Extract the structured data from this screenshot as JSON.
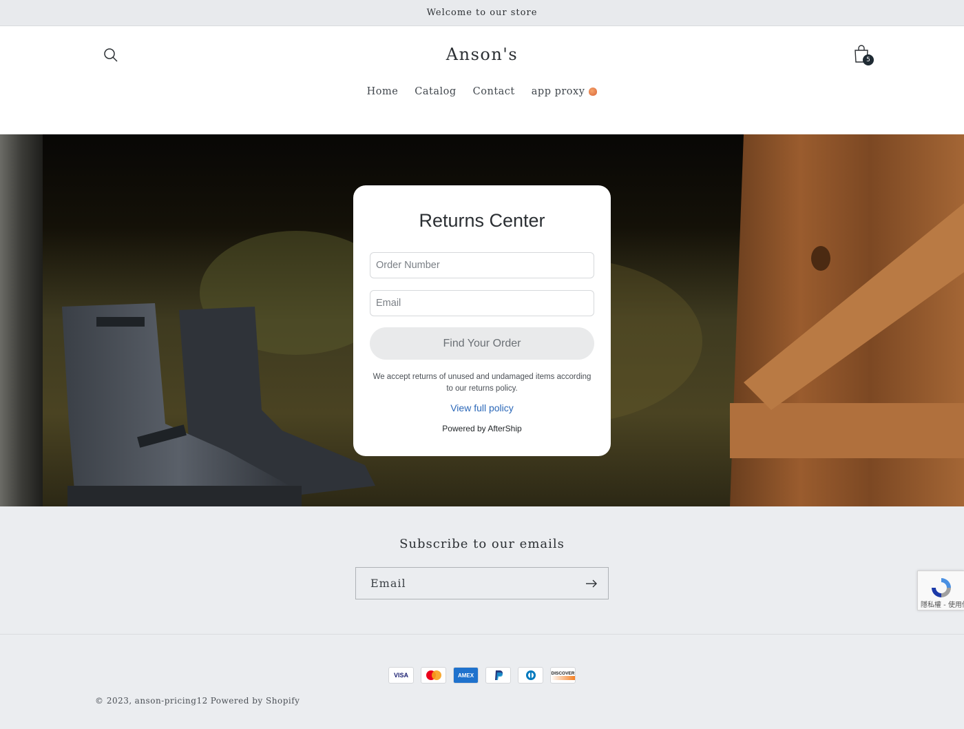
{
  "announcement": "Welcome to our store",
  "header": {
    "logo": "Anson's",
    "cart_count": "5",
    "nav": [
      {
        "label": "Home"
      },
      {
        "label": "Catalog"
      },
      {
        "label": "Contact"
      },
      {
        "label": "app proxy"
      }
    ]
  },
  "returns": {
    "title": "Returns Center",
    "order_placeholder": "Order Number",
    "email_placeholder": "Email",
    "button": "Find Your Order",
    "policy_text": "We accept returns of unused and undamaged items according to our returns policy.",
    "policy_link": "View full policy",
    "powered": "Powered by AfterShip"
  },
  "subscribe": {
    "title": "Subscribe to our emails",
    "email_placeholder": "Email"
  },
  "recaptcha": {
    "text": "隱私權 - 使用條款"
  },
  "payments": [
    "VISA",
    "Mastercard",
    "AMEX",
    "PayPal",
    "Diners",
    "DISCOVER"
  ],
  "footer": {
    "copyright": "© 2023,",
    "store": "anson-pricing12",
    "powered": "Powered by Shopify"
  },
  "colors": {
    "link": "#2a67b8",
    "cart_badge": "#1f2a33",
    "page_bg": "#ebedf0"
  }
}
